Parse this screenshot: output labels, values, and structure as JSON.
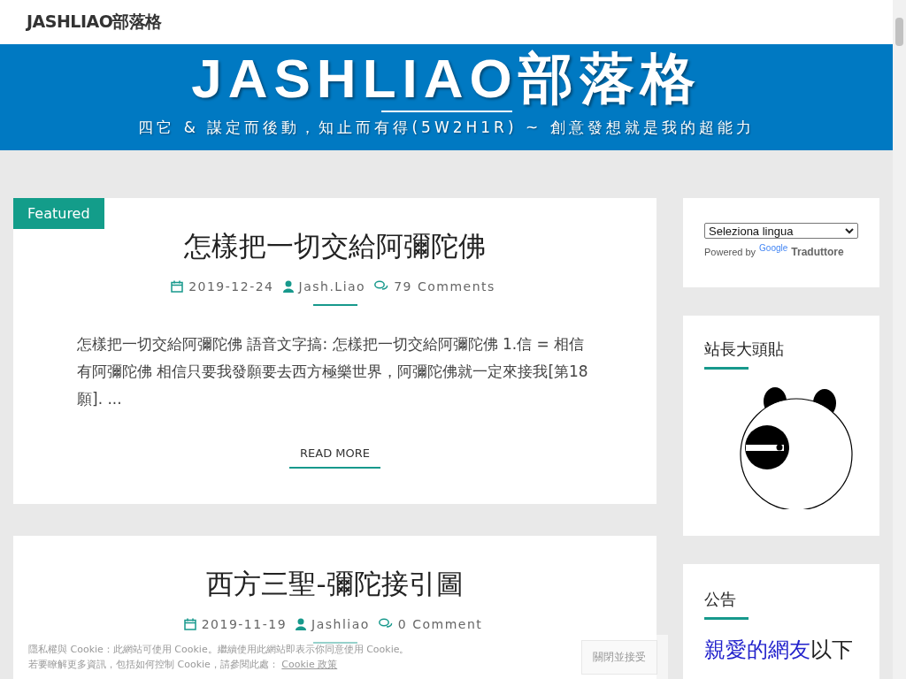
{
  "site_title": "JASHLIAO部落格",
  "header": {
    "title": "JASHLIAO部落格",
    "tagline": "四它 & 謀定而後動，知止而有得(5W2H1R) ~ 創意發想就是我的超能力"
  },
  "posts": [
    {
      "badge": "Featured",
      "title": "怎樣把一切交給阿彌陀佛",
      "date": "2019-12-24",
      "author": "Jash.Liao",
      "comments": "79 Comments",
      "excerpt": "怎樣把一切交給阿彌陀佛 語音文字搞: 怎樣把一切交給阿彌陀佛 1.信 = 相信有阿彌陀佛 相信只要我發願要去西方極樂世界，阿彌陀佛就一定來接我[第18願]. ...",
      "read_more": "READ MORE"
    },
    {
      "title": "西方三聖-彌陀接引圖",
      "date": "2019-11-19",
      "author": "Jashliao",
      "comments": "0 Comment"
    }
  ],
  "sidebar": {
    "translate": {
      "select": "Seleziona lingua",
      "powered_by": "Powered by",
      "google": "Google",
      "service": "Traduttore"
    },
    "avatar_widget": {
      "title": "站長大頭貼"
    },
    "notice_widget": {
      "title": "公告",
      "parts": [
        {
          "kind": "link",
          "text": "親愛的網友"
        },
        {
          "kind": "text",
          "text": "以下"
        }
      ]
    }
  },
  "cookie_banner": {
    "line1": "隱私權與 Cookie：此網站可使用 Cookie。繼續使用此網站即表示你同意使用 Cookie。",
    "line2": "若要瞭解更多資訊，包括如何控制 Cookie，請參閱此處：",
    "policy_link": "Cookie 政策",
    "button": "關閉並接受"
  }
}
